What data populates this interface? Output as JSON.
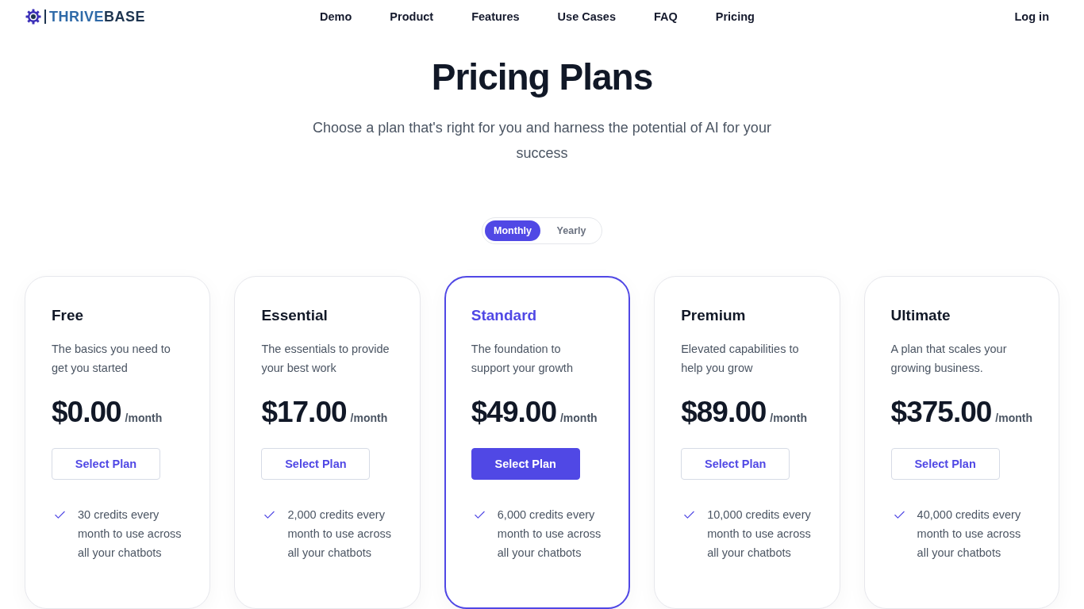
{
  "logo": {
    "parts": [
      {
        "text": "THRIVE",
        "color": "#2f6aa8"
      },
      {
        "text": "BASE",
        "color": "#1e3550"
      }
    ]
  },
  "nav": {
    "links": [
      "Demo",
      "Product",
      "Features",
      "Use Cases",
      "FAQ",
      "Pricing"
    ],
    "login": "Log in"
  },
  "hero": {
    "title": "Pricing Plans",
    "subtitle": "Choose a plan that's right for you and harness the potential of AI for your success"
  },
  "billing_toggle": [
    {
      "label": "Monthly",
      "selected": true
    },
    {
      "label": "Yearly",
      "selected": false
    }
  ],
  "plans": [
    {
      "name": "Free",
      "description": "The basics you need to get you started",
      "price": "$0.00",
      "period": "/month",
      "button": "Select Plan",
      "selected": false,
      "features": [
        "30 credits every month to use across all your chatbots"
      ]
    },
    {
      "name": "Essential",
      "description": "The essentials to provide your best work",
      "price": "$17.00",
      "period": "/month",
      "button": "Select Plan",
      "selected": false,
      "features": [
        "2,000 credits every month to use across all your chatbots"
      ]
    },
    {
      "name": "Standard",
      "description": "The foundation to support your growth",
      "price": "$49.00",
      "period": "/month",
      "button": "Select Plan",
      "selected": true,
      "features": [
        "6,000 credits every month to use across all your chatbots"
      ]
    },
    {
      "name": "Premium",
      "description": "Elevated capabilities to help you grow",
      "price": "$89.00",
      "period": "/month",
      "button": "Select Plan",
      "selected": false,
      "features": [
        "10,000 credits every month to use across all your chatbots"
      ]
    },
    {
      "name": "Ultimate",
      "description": "A plan that scales your growing business.",
      "price": "$375.00",
      "period": "/month",
      "button": "Select Plan",
      "selected": false,
      "features": [
        "40,000 credits every month to use across all your chatbots"
      ]
    }
  ]
}
